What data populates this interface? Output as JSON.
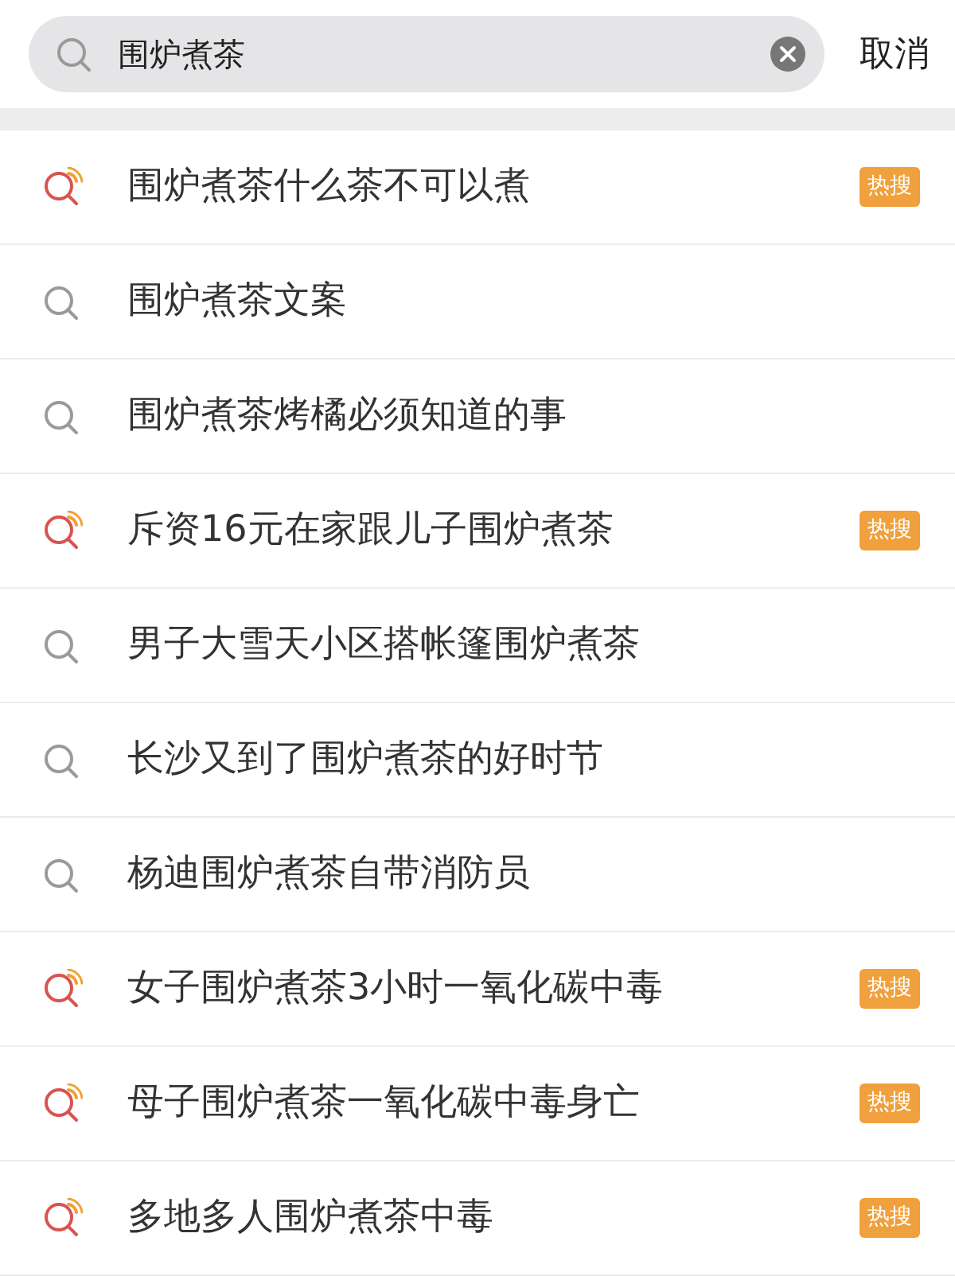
{
  "search": {
    "value": "围炉煮茶",
    "cancel": "取消"
  },
  "suggestions": [
    {
      "text": "围炉煮茶什么茶不可以煮",
      "hot": true,
      "badge": "热搜"
    },
    {
      "text": "围炉煮茶文案",
      "hot": false
    },
    {
      "text": "围炉煮茶烤橘必须知道的事",
      "hot": false
    },
    {
      "text": "斥资16元在家跟儿子围炉煮茶",
      "hot": true,
      "badge": "热搜"
    },
    {
      "text": "男子大雪天小区搭帐篷围炉煮茶",
      "hot": false
    },
    {
      "text": "长沙又到了围炉煮茶的好时节",
      "hot": false
    },
    {
      "text": "杨迪围炉煮茶自带消防员",
      "hot": false
    },
    {
      "text": "女子围炉煮茶3小时一氧化碳中毒",
      "hot": true,
      "badge": "热搜"
    },
    {
      "text": "母子围炉煮茶一氧化碳中毒身亡",
      "hot": true,
      "badge": "热搜"
    },
    {
      "text": "多地多人围炉煮茶中毒",
      "hot": true,
      "badge": "热搜"
    }
  ]
}
